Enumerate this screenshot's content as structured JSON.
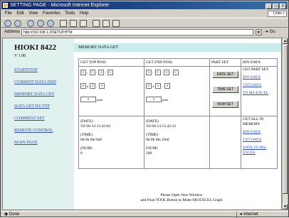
{
  "browser": {
    "title": "SETTING PAGE - Microsoft Internet Explorer",
    "menu": [
      "File",
      "Edit",
      "View",
      "Favorites",
      "Tools",
      "Help"
    ],
    "links_label": "Links",
    "address_label": "Address",
    "address_value": "http://192.168.1.2/SETUP.HTM",
    "go_label": "Go",
    "status_left": "Done",
    "status_right": "Internet"
  },
  "nav": {
    "brand": "HIOKI 8422",
    "version": "V 1.00",
    "items": [
      "STARTSTOP",
      "CURRENT DATA DISP",
      "MEMORY DATA GET",
      "DATA GET BY FTP",
      "COMMENT SET",
      "REMOTE CONTROL",
      "MAIN PAGE"
    ]
  },
  "main": {
    "header": "MEMORY DATA GET",
    "columns": [
      "GET TOP POSI.",
      "GET END POSI.",
      "PART SET",
      "BIN DATA"
    ],
    "top_pos": {
      "row1": [
        "0",
        "0",
        "0",
        "0"
      ],
      "row2": [
        "0",
        "0",
        "0"
      ],
      "row3": "0",
      "day_unit": "d",
      "point_unit": "point"
    },
    "end_pos": {
      "row1": [
        "0",
        "0",
        "0",
        "0"
      ],
      "row2": [
        "0",
        "0",
        "0"
      ],
      "row3": "0",
      "day_unit": "d",
      "point_unit": "point"
    },
    "buttons": {
      "date_set": "DATE SET",
      "time_set": "TIME SET",
      "num_set": "NUM SET"
    },
    "part_bin": {
      "title": "GET PART SET",
      "bin": "BIN DATA",
      "txt": "TXT DATA",
      "excel": "TO MS-EXCEL"
    },
    "top_info": {
      "date_label": "(DATE)",
      "date": "'02-06-14 15:42:02",
      "time_label": "(TIME)",
      "time": "0d 0h 0m 0s0",
      "num_label": "(NUM)",
      "num": "0"
    },
    "end_info": {
      "date_label": "(DATE)",
      "date": "'02-06-14 15:42:12",
      "time_label": "(TIME)",
      "time": "0d 0h 0m 10s0",
      "num_label": "(NUM)",
      "num": "100"
    },
    "all_bin": {
      "title": "GET ALL IN MEMORY",
      "bin": "BIN DATA",
      "txt": "TXT DATA",
      "excel": "DATA TO MS-EXCEL"
    },
    "note_line1": "Please Open New Window",
    "note_line2": "and Push TOOL Button to Make MS-EXCEL Graph"
  }
}
